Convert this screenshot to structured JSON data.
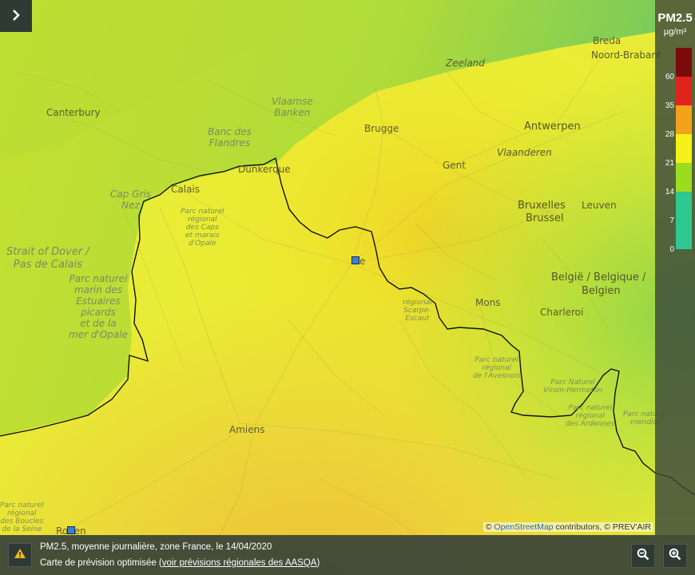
{
  "map": {
    "places": [
      {
        "id": "canterbury",
        "label": "Canterbury",
        "kind": "city"
      },
      {
        "id": "breda",
        "label": "Breda",
        "kind": "city"
      },
      {
        "id": "noord-brabant",
        "label": "Noord-Brabant",
        "kind": "city"
      },
      {
        "id": "zeeland",
        "label": "Zeeland",
        "kind": "city"
      },
      {
        "id": "brugge",
        "label": "Brugge",
        "kind": "city"
      },
      {
        "id": "antwerpen",
        "label": "Antwerpen",
        "kind": "big"
      },
      {
        "id": "vlaanderen",
        "label": "Vlaanderen",
        "kind": "city"
      },
      {
        "id": "gent",
        "label": "Gent",
        "kind": "city"
      },
      {
        "id": "dunkerque",
        "label": "Dunkerque",
        "kind": "city"
      },
      {
        "id": "calais",
        "label": "Calais",
        "kind": "city"
      },
      {
        "id": "bruxelles",
        "label": "Bruxelles",
        "kind": "big"
      },
      {
        "id": "brussel",
        "label": "Brussel",
        "kind": "big"
      },
      {
        "id": "leuven",
        "label": "Leuven",
        "kind": "city"
      },
      {
        "id": "belgie",
        "label": "België / Belgique /",
        "kind": "big"
      },
      {
        "id": "belgien",
        "label": "Belgien",
        "kind": "big"
      },
      {
        "id": "mons",
        "label": "Mons",
        "kind": "city"
      },
      {
        "id": "charleroi",
        "label": "Charleroi",
        "kind": "city"
      },
      {
        "id": "amiens",
        "label": "Amiens",
        "kind": "city"
      },
      {
        "id": "rouen",
        "label": "Rouen",
        "kind": "city"
      },
      {
        "id": "lille-fragment",
        "label": "e",
        "kind": "city"
      }
    ],
    "water_labels": [
      {
        "id": "vlaamse-banken",
        "lines": [
          "Vlaamse",
          "Banken"
        ]
      },
      {
        "id": "banc-des-flandres",
        "lines": [
          "Banc des",
          "Flandres"
        ]
      },
      {
        "id": "cap-gris-nez",
        "lines": [
          "Cap Gris",
          "Nez"
        ]
      },
      {
        "id": "strait-of-dover",
        "lines": [
          "Strait of Dover /",
          "Pas de Calais"
        ]
      },
      {
        "id": "parc-marin",
        "lines": [
          "Parc naturel",
          "marin des",
          "Estuaires",
          "picards",
          "et de la",
          "mer d'Opale"
        ]
      }
    ],
    "park_labels": [
      {
        "id": "parc-caps",
        "lines": [
          "Parc naturel",
          "régional",
          "des Caps",
          "et marais",
          "d'Opale"
        ]
      },
      {
        "id": "parc-scarpe",
        "lines": [
          "régional",
          "Scarpe-",
          "Escaut"
        ]
      },
      {
        "id": "parc-avesnois",
        "lines": [
          "Parc naturel",
          "régional",
          "de l'Avesnois"
        ]
      },
      {
        "id": "parc-viroin",
        "lines": [
          "Parc Naturel",
          "Viroin-Hermeton"
        ]
      },
      {
        "id": "parc-ardennes",
        "lines": [
          "Parc naturel",
          "régional",
          "des Ardennes"
        ]
      },
      {
        "id": "parc-mendip",
        "lines": [
          "Parc nature",
          "mendio"
        ]
      },
      {
        "id": "parc-boucles",
        "lines": [
          "Parc naturel",
          "régional",
          "des Boucles",
          "de la Seine"
        ]
      }
    ],
    "station_markers": [
      {
        "id": "lille-station",
        "color": "#3b7fd6"
      },
      {
        "id": "rouen-station",
        "color": "#3b7fd6"
      }
    ]
  },
  "legend": {
    "title": "PM2.5",
    "unit": "µg/m³",
    "ticks": [
      "60",
      "35",
      "28",
      "21",
      "14",
      "7",
      "0"
    ],
    "colors": [
      "#7a0b0b",
      "#e0241d",
      "#f2a21b",
      "#f5f21a",
      "#9bdc1e",
      "#2fc890",
      "#2fc890"
    ]
  },
  "attribution": {
    "prefix": "© ",
    "link": "OpenStreetMap",
    "suffix": " contributors, © PREV'AIR"
  },
  "footer": {
    "line1": "PM2.5, moyenne journalière, zone France, le 14/04/2020",
    "line2_prefix": "Carte de prévision optimisée (",
    "line2_link": "voir prévisions régionales des AASQA",
    "line2_suffix": ")"
  },
  "controls": {
    "toggle_icon": "chevron-right-icon",
    "warning_icon": "warning-icon",
    "zoom_out_icon": "zoom-out-icon",
    "zoom_in_icon": "zoom-in-icon"
  }
}
